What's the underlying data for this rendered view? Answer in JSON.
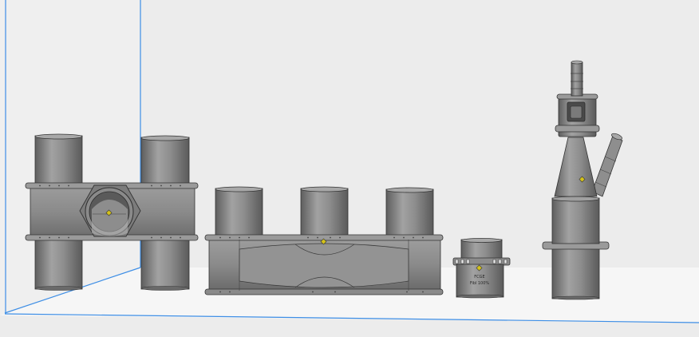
{
  "colors": {
    "background": "#ececec",
    "bed_floor": "#f6f6f6",
    "bed_edge": "#3d8ee6",
    "part_fill": "#8f8f8f",
    "part_shadow": "#6b6b6b",
    "part_edge": "#3a3a3a",
    "part_highlight": "#a9a9a9",
    "origin_marker": "#d4c21a"
  },
  "scene": {
    "bed": {
      "name": "build-plate"
    },
    "parts": [
      {
        "id": "part-1",
        "name": "double-tee-fitting-side-port",
        "selected": false
      },
      {
        "id": "part-2",
        "name": "triple-port-manifold",
        "selected": false
      },
      {
        "id": "part-3",
        "name": "threaded-cap",
        "selected": false,
        "label_lines": [
          "FCGE",
          "Fibl 100%"
        ]
      },
      {
        "id": "part-4",
        "name": "cone-adapter-with-barb",
        "selected": false
      }
    ]
  }
}
